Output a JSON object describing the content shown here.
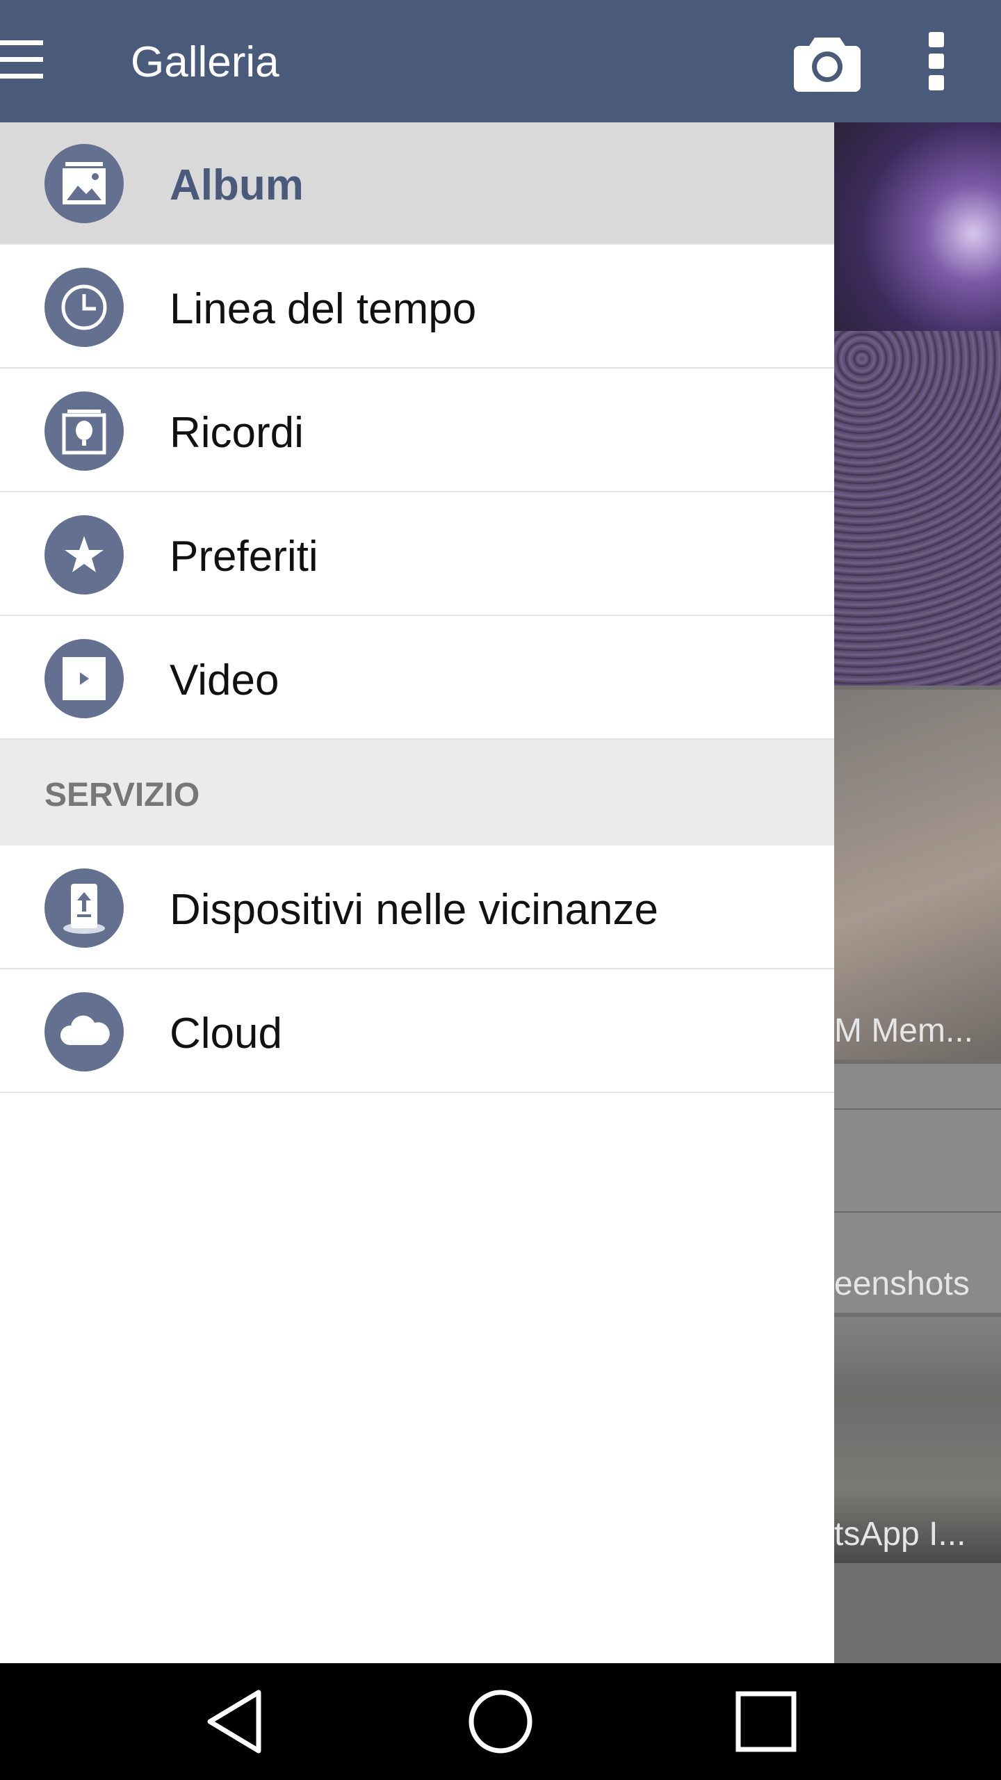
{
  "app_bar": {
    "title": "Galleria",
    "menu_icon": "hamburger-menu-icon",
    "camera_icon": "camera-icon",
    "more_icon": "more-vertical-icon",
    "color": "#4a5a7b"
  },
  "drawer": {
    "items": [
      {
        "label": "Album",
        "icon": "album-icon",
        "selected": true
      },
      {
        "label": "Linea del tempo",
        "icon": "clock-icon",
        "selected": false
      },
      {
        "label": "Ricordi",
        "icon": "memories-balloon-icon",
        "selected": false
      },
      {
        "label": "Preferiti",
        "icon": "star-icon",
        "selected": false
      },
      {
        "label": "Video",
        "icon": "play-icon",
        "selected": false
      }
    ],
    "section_header": "SERVIZIO",
    "service_items": [
      {
        "label": "Dispositivi nelle vicinanze",
        "icon": "nearby-device-icon"
      },
      {
        "label": "Cloud",
        "icon": "cloud-icon"
      }
    ],
    "icon_color": "#63708f"
  },
  "background_gallery": {
    "captions": [
      "M Mem...",
      "eenshots",
      "tsApp I..."
    ]
  },
  "system_nav": {
    "back_icon": "back-triangle-icon",
    "home_icon": "home-circle-icon",
    "recents_icon": "recents-square-icon"
  }
}
